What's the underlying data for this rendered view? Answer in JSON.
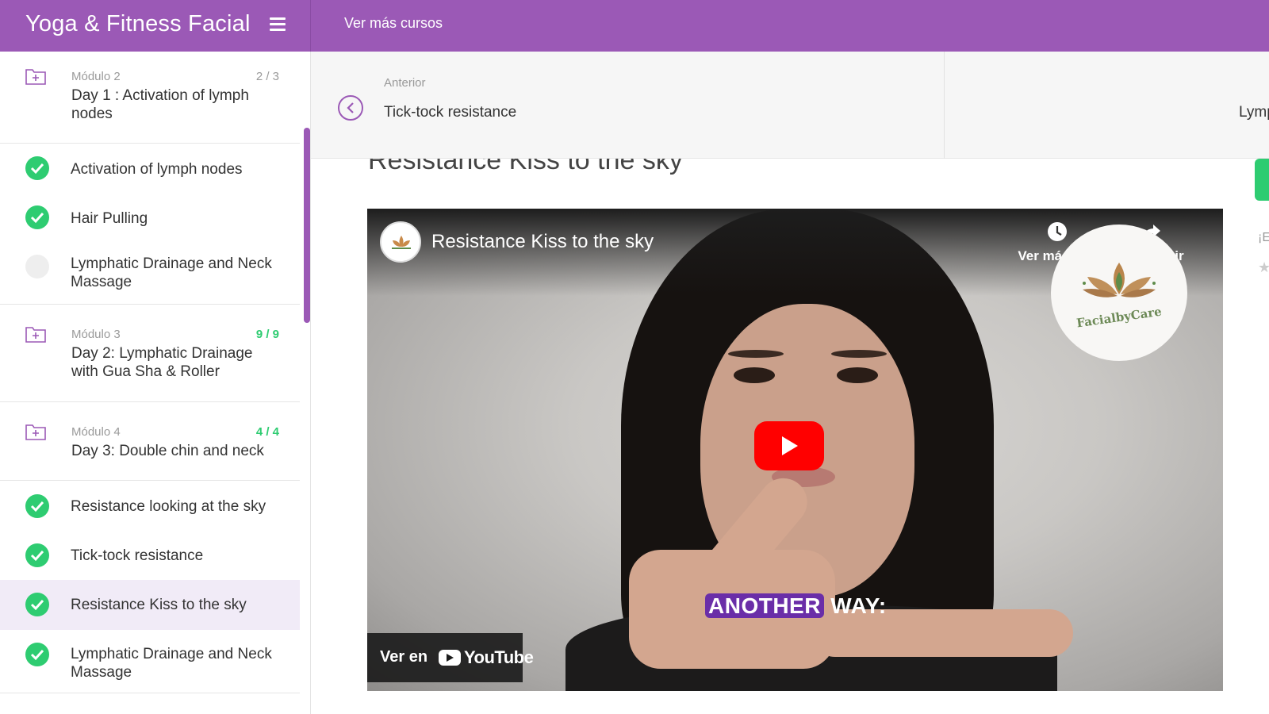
{
  "header": {
    "brand": "Yoga & Fitness Facial",
    "more_courses": "Ver más cursos"
  },
  "sidebar": {
    "modules": [
      {
        "label": "Módulo 2",
        "count": "2 / 3",
        "complete": false,
        "title": "Day 1 : Activation of lymph nodes"
      },
      {
        "label": "Módulo 3",
        "count": "9 / 9",
        "complete": true,
        "title": "Day 2: Lymphatic Drainage with Gua Sha & Roller"
      },
      {
        "label": "Módulo 4",
        "count": "4 / 4",
        "complete": true,
        "title": "Day 3: Double chin and neck"
      }
    ],
    "lessons": [
      {
        "title": "Activation of lymph nodes",
        "status": "done"
      },
      {
        "title": "Hair Pulling",
        "status": "done"
      },
      {
        "title": "Lymphatic Drainage and Neck Massage",
        "status": "pending"
      },
      {
        "title": "Resistance looking at the sky",
        "status": "done"
      },
      {
        "title": "Tick-tock resistance",
        "status": "done"
      },
      {
        "title": "Resistance Kiss to the sky",
        "status": "done",
        "active": true
      },
      {
        "title": "Lymphatic Drainage and Neck Massage",
        "status": "done"
      }
    ]
  },
  "nav": {
    "prev_label": "Anterior",
    "prev_title": "Tick-tock resistance",
    "next_title": "Lymp"
  },
  "lesson": {
    "heading": "Resistance Kiss to the sky"
  },
  "side_panel": {
    "text": "¡Ev",
    "star_icon": "star-icon"
  },
  "video": {
    "title": "Resistance Kiss to the sky",
    "watch_later": "Ver más ta...",
    "share": "Compartir",
    "watermark": "FacialbyCare",
    "caption_highlight": "ANOTHER",
    "caption_rest": " WAY:",
    "watch_on": "Ver en",
    "youtube": "YouTube"
  },
  "colors": {
    "brand_purple": "#9b59b6",
    "success_green": "#2ecc71",
    "youtube_red": "#ff0000"
  }
}
